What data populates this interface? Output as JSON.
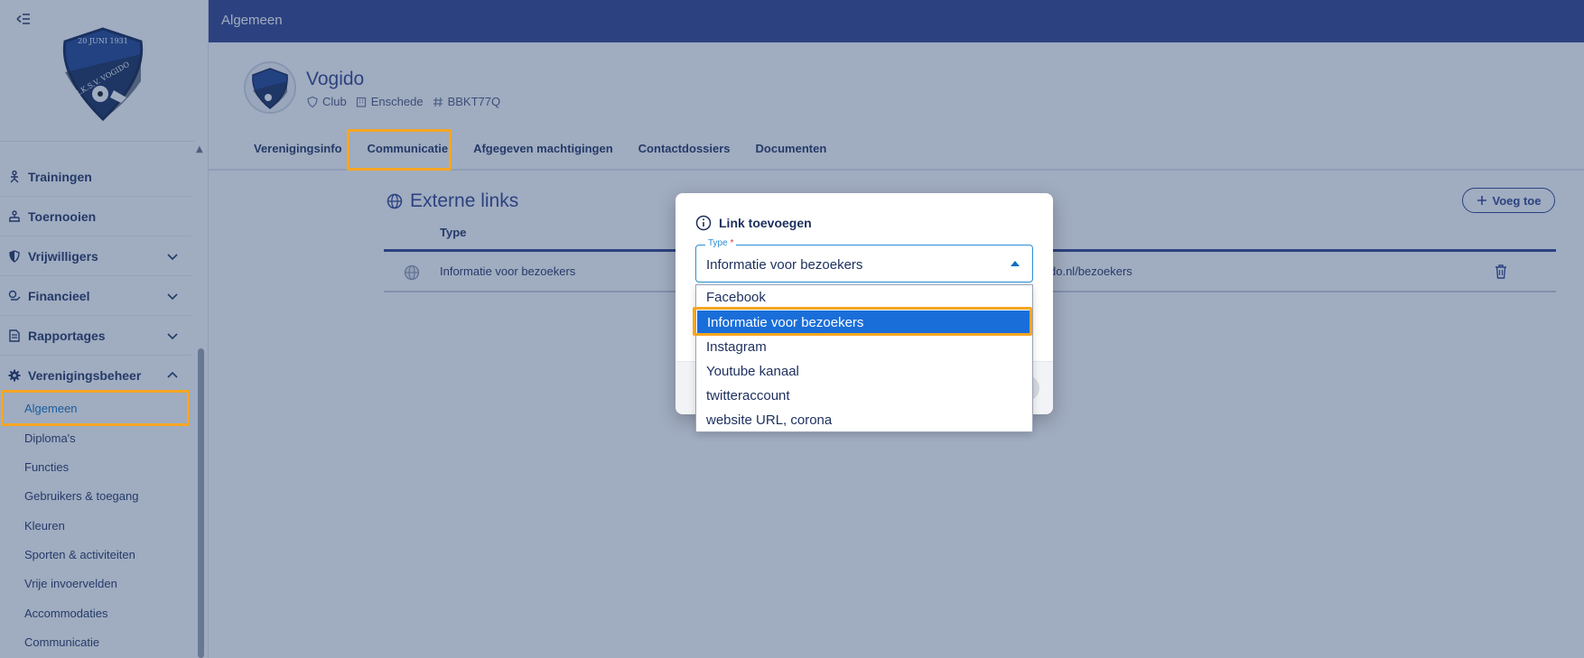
{
  "sidebar": {
    "items": [
      {
        "label": "Trainingen",
        "icon": "trainer-icon"
      },
      {
        "label": "Toernooien",
        "icon": "tournament-icon"
      },
      {
        "label": "Vrijwilligers",
        "icon": "shield-icon"
      },
      {
        "label": "Financieel",
        "icon": "money-icon"
      },
      {
        "label": "Rapportages",
        "icon": "report-icon"
      },
      {
        "label": "Verenigingsbeheer",
        "icon": "gear-icon"
      }
    ],
    "sub_items": [
      "Algemeen",
      "Diploma's",
      "Functies",
      "Gebruikers & toegang",
      "Kleuren",
      "Sporten & activiteiten",
      "Vrije invoervelden",
      "Accommodaties",
      "Communicatie"
    ],
    "logo_text": {
      "date": "20 JUNI 1931",
      "name": "R.K.S.V. VOGIDO"
    }
  },
  "topbar": {
    "title": "Algemeen"
  },
  "club": {
    "name": "Vogido",
    "type": "Club",
    "city": "Enschede",
    "code": "BBKT77Q"
  },
  "tabs": [
    "Verenigingsinfo",
    "Communicatie",
    "Afgegeven machtigingen",
    "Contactdossiers",
    "Documenten"
  ],
  "external_links": {
    "title": "Externe links",
    "add_label": "Voeg toe",
    "column_type": "Type",
    "rows": [
      {
        "type": "Informatie voor bezoekers",
        "url_visible": "do.nl/bezoekers"
      }
    ]
  },
  "modal": {
    "title": "Link toevoegen",
    "field_label": "Type",
    "required_mark": "*",
    "selected_value": "Informatie voor bezoekers",
    "options": [
      "Facebook",
      "Informatie voor bezoekers",
      "Instagram",
      "Youtube kanaal",
      "twitteraccount",
      "website URL, corona"
    ],
    "selected_index": 1
  },
  "colors": {
    "topbar": "#2c3f8a",
    "accent": "#0b6fbf",
    "selection": "#1a6ed9",
    "highlight": "#f5a623"
  }
}
